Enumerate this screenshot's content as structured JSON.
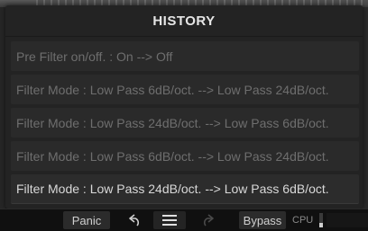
{
  "panel": {
    "title": "HISTORY"
  },
  "history": {
    "items": [
      {
        "text": "Pre Filter on/off. : On --> Off"
      },
      {
        "text": "Filter Mode : Low Pass 6dB/oct. --> Low Pass 24dB/oct."
      },
      {
        "text": "Filter Mode : Low Pass 24dB/oct. --> Low Pass 6dB/oct."
      },
      {
        "text": "Filter Mode : Low Pass 6dB/oct. --> Low Pass 24dB/oct."
      },
      {
        "text": "Filter Mode : Low Pass 24dB/oct. --> Low Pass 6dB/oct."
      }
    ],
    "current_index": 4
  },
  "toolbar": {
    "panic_label": "Panic",
    "undo_icon": "undo-arrow-icon",
    "menu_icon": "hamburger-menu-icon",
    "redo_icon": "redo-arrow-icon",
    "bypass_label": "Bypass",
    "cpu_label": "CPU",
    "cpu_load": 0.3
  },
  "colors": {
    "panel_bg": "#232323",
    "row_bg": "#2a2a2a",
    "row_text_inactive": "#6e6e6e",
    "row_text_current": "#d8d8d8",
    "title_text": "#e6e6e6",
    "toolbar_bg": "#101010"
  }
}
